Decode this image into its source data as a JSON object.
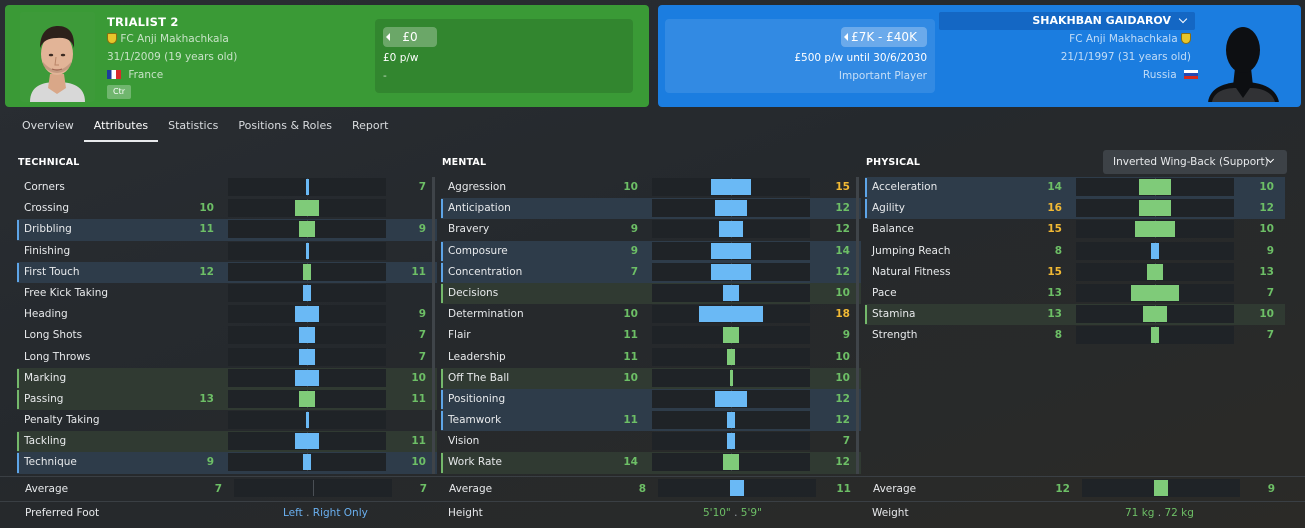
{
  "player_left": {
    "name": "TRIALIST 2",
    "club": "FC Anji Makhachkala",
    "dob": "31/1/2009 (19 years old)",
    "nationality": "France",
    "role_tag": "Ctr",
    "value": "£0",
    "wage": "£0 p/w",
    "contract_status": "-",
    "card_color": "#3a9a36"
  },
  "player_right": {
    "name": "SHAKHBAN GAIDAROV",
    "club": "FC Anji Makhachkala",
    "dob": "21/1/1997 (31 years old)",
    "nationality": "Russia",
    "value": "£7K - £40K",
    "wage": "£500 p/w until 30/6/2030",
    "squad_status": "Important Player",
    "card_color": "#1b7de0"
  },
  "tabs": [
    {
      "label": "Overview",
      "active": false
    },
    {
      "label": "Attributes",
      "active": true
    },
    {
      "label": "Statistics",
      "active": false
    },
    {
      "label": "Positions & Roles",
      "active": false
    },
    {
      "label": "Report",
      "active": false
    }
  ],
  "role_selector": "Inverted Wing-Back (Support)",
  "colors": {
    "left_player": "#7fcb79",
    "right_player": "#6ab9f5",
    "gold_value": "#f1b934",
    "green_value": "#6dbf66"
  },
  "technical": {
    "title": "TECHNICAL",
    "attributes": [
      {
        "name": "Corners",
        "left": null,
        "right": "7",
        "lv": 7,
        "rv": 7,
        "hl": ""
      },
      {
        "name": "Crossing",
        "left": "10",
        "right": null,
        "lv": 10,
        "rv": 7,
        "hl": ""
      },
      {
        "name": "Dribbling",
        "left": "11",
        "right": "9",
        "lv": 11,
        "rv": 9,
        "hl": "blue"
      },
      {
        "name": "Finishing",
        "left": null,
        "right": null,
        "lv": 7,
        "rv": 7,
        "hl": ""
      },
      {
        "name": "First Touch",
        "left": "12",
        "right": "11",
        "lv": 12,
        "rv": 11,
        "hl": "blue"
      },
      {
        "name": "Free Kick Taking",
        "left": null,
        "right": null,
        "lv": 6,
        "rv": 7,
        "hl": ""
      },
      {
        "name": "Heading",
        "left": null,
        "right": "9",
        "lv": 6,
        "rv": 9,
        "hl": ""
      },
      {
        "name": "Long Shots",
        "left": null,
        "right": "7",
        "lv": 5,
        "rv": 7,
        "hl": ""
      },
      {
        "name": "Long Throws",
        "left": null,
        "right": "7",
        "lv": 5,
        "rv": 7,
        "hl": ""
      },
      {
        "name": "Marking",
        "left": null,
        "right": "10",
        "lv": 7,
        "rv": 10,
        "hl": "green"
      },
      {
        "name": "Passing",
        "left": "13",
        "right": "11",
        "lv": 13,
        "rv": 11,
        "hl": "green"
      },
      {
        "name": "Penalty Taking",
        "left": null,
        "right": null,
        "lv": 7,
        "rv": 7,
        "hl": ""
      },
      {
        "name": "Tackling",
        "left": null,
        "right": "11",
        "lv": 8,
        "rv": 11,
        "hl": "green"
      },
      {
        "name": "Technique",
        "left": "9",
        "right": "10",
        "lv": 9,
        "rv": 10,
        "hl": "blue"
      }
    ],
    "average_label": "Average",
    "average_left": "7",
    "average_right": "7"
  },
  "mental": {
    "title": "MENTAL",
    "attributes": [
      {
        "name": "Aggression",
        "left": "10",
        "right": "15",
        "lv": 10,
        "rv": 15,
        "hl": "",
        "rgold": true
      },
      {
        "name": "Anticipation",
        "left": null,
        "right": "12",
        "lv": 8,
        "rv": 12,
        "hl": "blue"
      },
      {
        "name": "Bravery",
        "left": "9",
        "right": "12",
        "lv": 9,
        "rv": 12,
        "hl": ""
      },
      {
        "name": "Composure",
        "left": "9",
        "right": "14",
        "lv": 9,
        "rv": 14,
        "hl": "blue"
      },
      {
        "name": "Concentration",
        "left": "7",
        "right": "12",
        "lv": 7,
        "rv": 12,
        "hl": "blue"
      },
      {
        "name": "Decisions",
        "left": null,
        "right": "10",
        "lv": 8,
        "rv": 10,
        "hl": "green"
      },
      {
        "name": "Determination",
        "left": "10",
        "right": "18",
        "lv": 10,
        "rv": 18,
        "hl": "",
        "rgold": true
      },
      {
        "name": "Flair",
        "left": "11",
        "right": "9",
        "lv": 11,
        "rv": 9,
        "hl": ""
      },
      {
        "name": "Leadership",
        "left": "11",
        "right": "10",
        "lv": 11,
        "rv": 10,
        "hl": ""
      },
      {
        "name": "Off The Ball",
        "left": "10",
        "right": "10",
        "lv": 10,
        "rv": 10,
        "hl": "green"
      },
      {
        "name": "Positioning",
        "left": null,
        "right": "12",
        "lv": 8,
        "rv": 12,
        "hl": "blue"
      },
      {
        "name": "Teamwork",
        "left": "11",
        "right": "12",
        "lv": 11,
        "rv": 12,
        "hl": "blue"
      },
      {
        "name": "Vision",
        "left": null,
        "right": "7",
        "lv": 6,
        "rv": 7,
        "hl": ""
      },
      {
        "name": "Work Rate",
        "left": "14",
        "right": "12",
        "lv": 14,
        "rv": 12,
        "hl": "green"
      }
    ],
    "average_label": "Average",
    "average_left": "8",
    "average_right": "11"
  },
  "physical": {
    "title": "PHYSICAL",
    "attributes": [
      {
        "name": "Acceleration",
        "left": "14",
        "right": "10",
        "lv": 14,
        "rv": 10,
        "hl": "blue"
      },
      {
        "name": "Agility",
        "left": "16",
        "right": "12",
        "lv": 16,
        "rv": 12,
        "hl": "blue",
        "lgold": true
      },
      {
        "name": "Balance",
        "left": "15",
        "right": "10",
        "lv": 15,
        "rv": 10,
        "hl": "",
        "lgold": true
      },
      {
        "name": "Jumping Reach",
        "left": "8",
        "right": "9",
        "lv": 8,
        "rv": 9,
        "hl": ""
      },
      {
        "name": "Natural Fitness",
        "left": "15",
        "right": "13",
        "lv": 15,
        "rv": 13,
        "hl": "",
        "lgold": true
      },
      {
        "name": "Pace",
        "left": "13",
        "right": "7",
        "lv": 13,
        "rv": 7,
        "hl": ""
      },
      {
        "name": "Stamina",
        "left": "13",
        "right": "10",
        "lv": 13,
        "rv": 10,
        "hl": "green"
      },
      {
        "name": "Strength",
        "left": "8",
        "right": "7",
        "lv": 8,
        "rv": 7,
        "hl": ""
      }
    ],
    "average_label": "Average",
    "average_left": "12",
    "average_right": "9"
  },
  "footer": {
    "preferred_foot_label": "Preferred Foot",
    "preferred_foot_left": "Left",
    "preferred_foot_right": "Right Only",
    "height_label": "Height",
    "height_left": "5'10\"",
    "height_right": "5'9\"",
    "weight_label": "Weight",
    "weight_left": "71 kg",
    "weight_right": "72 kg",
    "separator": "."
  }
}
